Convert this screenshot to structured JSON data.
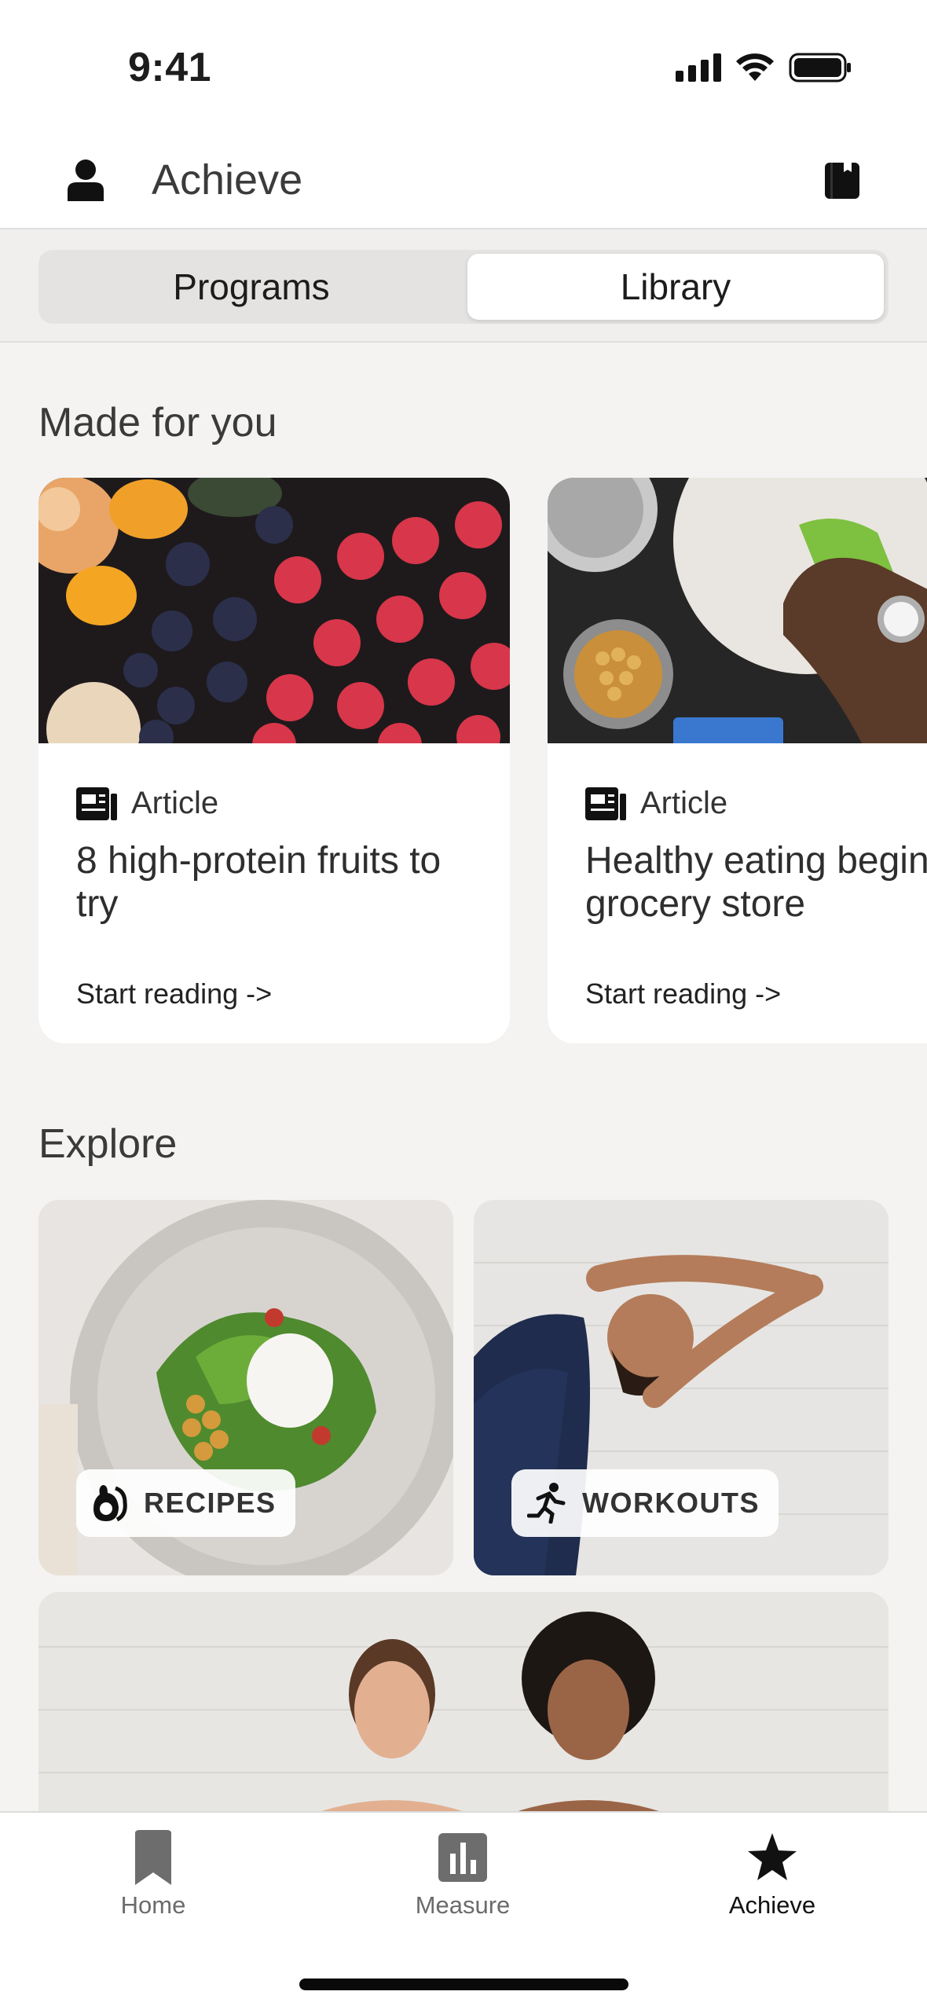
{
  "status_bar": {
    "time": "9:41"
  },
  "header": {
    "title": "Achieve"
  },
  "segments": {
    "programs": "Programs",
    "library": "Library",
    "selected": "Library"
  },
  "made_for_you": {
    "title": "Made for you",
    "cards": [
      {
        "type": "Article",
        "title": "8 high-protein fruits to try",
        "cta": "Start reading ->"
      },
      {
        "type": "Article",
        "title": "Healthy eating begins in the grocery store",
        "cta": "Start reading ->"
      }
    ]
  },
  "explore": {
    "title": "Explore",
    "tiles": [
      {
        "label": "RECIPES",
        "icon": "avocado-icon"
      },
      {
        "label": "WORKOUTS",
        "icon": "running-icon"
      }
    ]
  },
  "bottom_nav": {
    "items": [
      {
        "label": "Home",
        "icon": "bookmark-icon"
      },
      {
        "label": "Measure",
        "icon": "bar-chart-icon"
      },
      {
        "label": "Achieve",
        "icon": "star-icon",
        "active": true
      }
    ]
  },
  "colors": {
    "accent": "#111111",
    "background": "#f4f3f2"
  }
}
